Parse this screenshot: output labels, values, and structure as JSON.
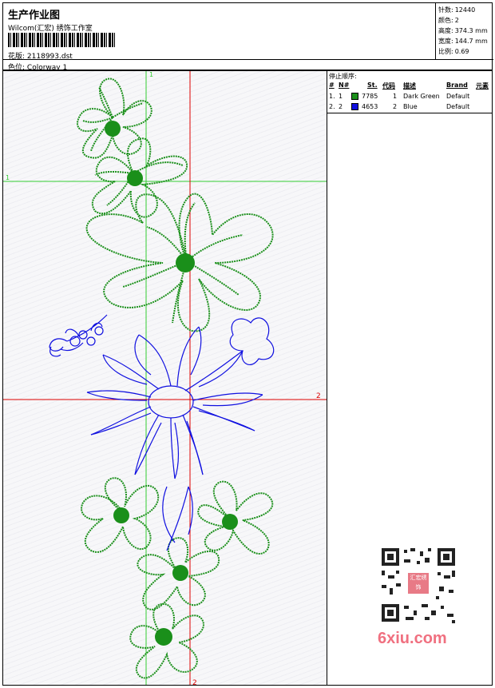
{
  "header": {
    "title": "生产作业图",
    "company": "Wilcom(汇宏) 绣饰工作室",
    "design_label": "花版:",
    "design_value": "2118993.dst",
    "colorway_label": "色位:",
    "colorway_value": "Colorway 1"
  },
  "stats": [
    {
      "label": "针数:",
      "value": "12440"
    },
    {
      "label": "颜色:",
      "value": "2"
    },
    {
      "label": "高度:",
      "value": "374.3 mm"
    },
    {
      "label": "宽度:",
      "value": "144.7 mm"
    },
    {
      "label": "比例:",
      "value": "0.69"
    }
  ],
  "stop_sequence": {
    "title": "停止顺序:",
    "headers": {
      "num": "#",
      "n": "N#",
      "st": "St.",
      "code": "代码",
      "desc": "描述",
      "brand": "Brand",
      "element": "元素"
    },
    "rows": [
      {
        "num": "1.",
        "n": "1",
        "color": "#1a8f1a",
        "st": "7785",
        "code": "1",
        "desc": "Dark Green",
        "brand": "Default"
      },
      {
        "num": "2.",
        "n": "2",
        "color": "#1010e0",
        "st": "4653",
        "code": "2",
        "desc": "Blue",
        "brand": "Default"
      }
    ]
  },
  "guides": {
    "green_label_1": "1",
    "green_label_top": "1",
    "red_label_2": "2",
    "red_label_bottom": "2"
  },
  "colors": {
    "dark_green": "#1a8f1a",
    "blue": "#1010e0",
    "guide_green": "#33cc33",
    "guide_red": "#dd0000"
  },
  "watermark": {
    "text": "6xiu.com",
    "qr_center_text": "汇宏绣饰"
  }
}
